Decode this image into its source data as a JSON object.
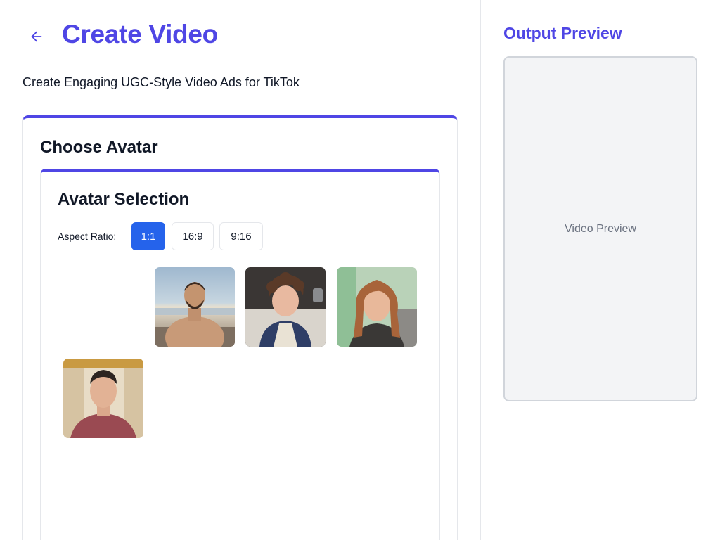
{
  "header": {
    "title": "Create Video",
    "subtitle": "Create Engaging UGC-Style Video Ads for TikTok"
  },
  "avatar_section": {
    "title": "Choose Avatar",
    "panel_title": "Avatar Selection",
    "aspect_ratio_label": "Aspect Ratio:",
    "aspect_ratios": [
      "1:1",
      "16:9",
      "9:16"
    ],
    "selected_ratio": "1:1"
  },
  "avatars": [
    {
      "name": "beach-man"
    },
    {
      "name": "curly-hair-person"
    },
    {
      "name": "smiling-woman"
    },
    {
      "name": "man-red-shirt"
    }
  ],
  "preview": {
    "title": "Output Preview",
    "placeholder": "Video Preview"
  },
  "colors": {
    "accent": "#4f46e5",
    "active_button": "#2563eb"
  }
}
